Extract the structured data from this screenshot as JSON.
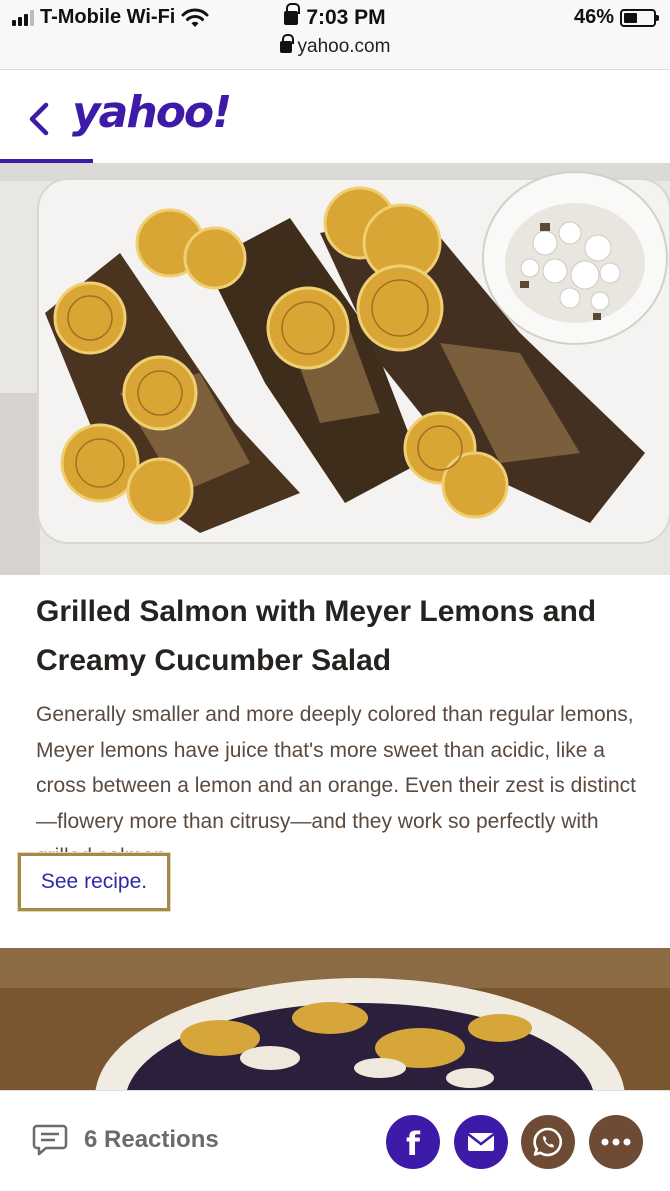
{
  "status_bar": {
    "carrier": "T-Mobile Wi-Fi",
    "time": "7:03 PM",
    "battery": "46%",
    "battery_level": 0.46,
    "url": "yahoo.com"
  },
  "header": {
    "logo": "yahoo!",
    "back_icon": "chevron-left-icon"
  },
  "article": {
    "headline": "Grilled Salmon with Meyer Lemons and Creamy Cucumber Salad",
    "description": "Generally smaller and more deeply colored than regular lemons, Meyer lemons have juice that's more sweet than acidic, like a cross between a lemon and an orange. Even their zest is distinct—flowery more than citrusy—and they work so perfectly with grilled salmon.",
    "link_label": "See recipe."
  },
  "bottom_bar": {
    "reactions_label": "6 Reactions",
    "share_icons": [
      "facebook-icon",
      "mail-icon",
      "whatsapp-icon",
      "more-icon"
    ]
  },
  "colors": {
    "brand": "#3e1aa8",
    "link": "#2f2aa6",
    "highlight_border": "#a38a4a",
    "share_brown": "#6d4b34"
  }
}
